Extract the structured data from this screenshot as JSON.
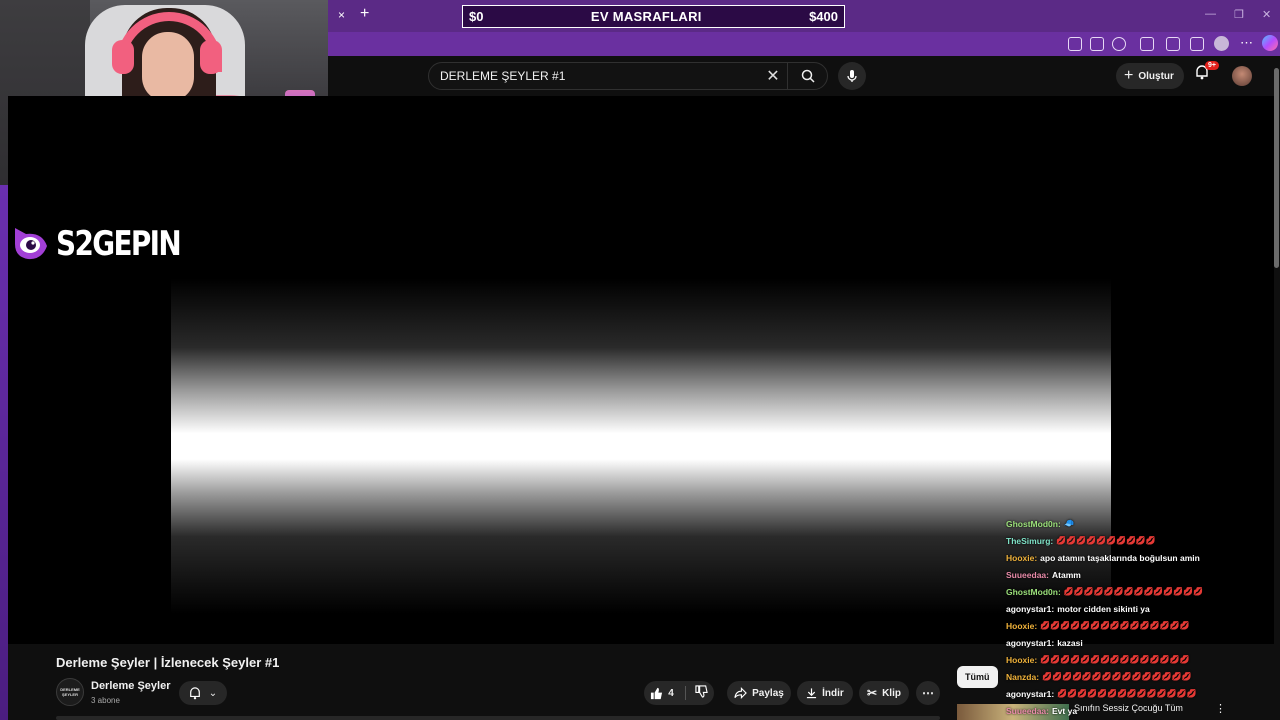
{
  "overlay": {
    "expense_left": "$0",
    "expense_title": "EV MASRAFLARI",
    "expense_right": "$400",
    "brand_name": "S2GEPIN"
  },
  "browser": {
    "tab_close": "×",
    "new_tab": "+"
  },
  "header": {
    "search_value": "DERLEME ŞEYLER #1",
    "create_label": "Oluştur",
    "notif_badge": "9+"
  },
  "video": {
    "title": "Derleme Şeyler | İzlenecek Şeyler #1",
    "channel_avatar_text": "DERLEME ŞEYLER",
    "channel_name": "Derleme Şeyler",
    "subscribers": "3 abone",
    "likes": "4",
    "share_label": "Paylaş",
    "download_label": "İndir",
    "clip_label": "Klip"
  },
  "sidebar": {
    "chip_all": "Tümü",
    "rec_title": "Sınıfın Sessiz Çocuğu Tüm"
  },
  "chat": {
    "messages": [
      {
        "user": "GhostMod0n:",
        "text": "🧢",
        "color": "#9be07a"
      },
      {
        "user": "TheSimurg:",
        "text": "💋💋💋💋💋💋💋💋💋💋",
        "color": "#7fe3c8"
      },
      {
        "user": "Hooxie:",
        "text": "apo atamın taşaklarında boğulsun amin",
        "color": "#f0b23a"
      },
      {
        "user": "Suueedaa:",
        "text": "Atamm",
        "color": "#e88aa8"
      },
      {
        "user": "GhostMod0n:",
        "text": "💋💋💋💋💋💋💋💋💋💋💋💋💋💋",
        "color": "#9be07a"
      },
      {
        "user": "agonystar1:",
        "text": "motor cidden sikinti ya",
        "color": "#ffffff"
      },
      {
        "user": "Hooxie:",
        "text": "💋💋💋💋💋💋💋💋💋💋💋💋💋💋💋",
        "color": "#f0b23a"
      },
      {
        "user": "agonystar1:",
        "text": "kazasi",
        "color": "#ffffff"
      },
      {
        "user": "Hooxie:",
        "text": "💋💋💋💋💋💋💋💋💋💋💋💋💋💋💋",
        "color": "#f0b23a"
      },
      {
        "user": "Nanzda:",
        "text": "💋💋💋💋💋💋💋💋💋💋💋💋💋💋💋",
        "color": "#f0b23a"
      },
      {
        "user": "agonystar1:",
        "text": "💋💋💋💋💋💋💋💋💋💋💋💋💋💋",
        "color": "#ffffff"
      },
      {
        "user": "Suueedaa:",
        "text": "Evt ya",
        "color": "#e88aa8"
      }
    ]
  },
  "colors": {
    "accent": "#6a30a0",
    "expense_bg": "#2b0a45"
  }
}
